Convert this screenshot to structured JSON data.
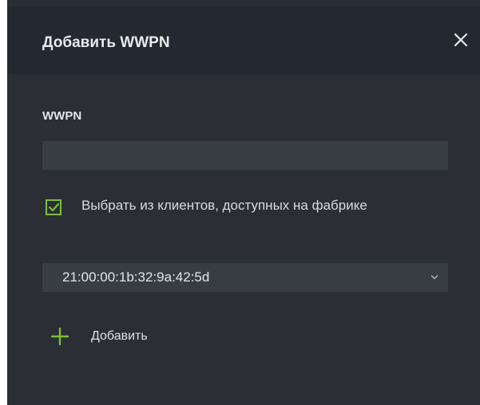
{
  "dialog": {
    "title": "Добавить WWPN",
    "close_icon": "close-icon"
  },
  "form": {
    "wwpn_label": "WWPN",
    "wwpn_value": "",
    "checkbox": {
      "checked": true,
      "label": "Выбрать из клиентов, доступных на фабрике",
      "color": "#7bbf3a"
    },
    "select": {
      "value": "21:00:00:1b:32:9a:42:5d",
      "icon": "chevron-down-icon"
    },
    "add": {
      "label": "Добавить",
      "icon": "plus-icon",
      "color": "#7bbf3a"
    }
  },
  "colors": {
    "accent": "#7bbf3a",
    "dialog_bg": "#2b2f35",
    "header_bg": "#242830",
    "field_bg": "#383d44"
  }
}
